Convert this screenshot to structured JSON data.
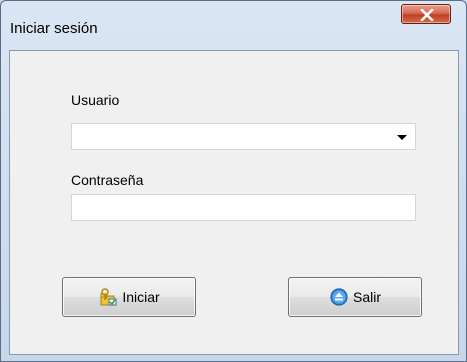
{
  "window": {
    "title": "Iniciar sesión",
    "close_glyph": "X"
  },
  "form": {
    "user_label": "Usuario",
    "user_value": "",
    "password_label": "Contraseña",
    "password_value": "",
    "password_placeholder": ""
  },
  "buttons": {
    "login_label": "Iniciar",
    "login_icon": "key-folder-icon",
    "exit_label": "Salir",
    "exit_icon": "eject-icon"
  },
  "colors": {
    "close_button": "#c14025",
    "client_background": "#f0f0f0",
    "frame": "#c6d7eb"
  }
}
